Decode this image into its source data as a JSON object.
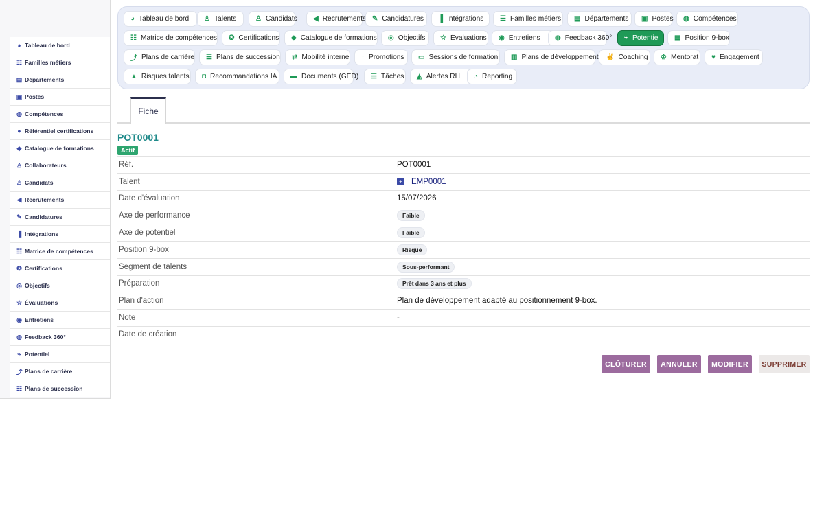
{
  "sidebar": {
    "items": [
      {
        "label": "Tableau de bord",
        "icon": "dashboard-icon",
        "glyph": "◕"
      },
      {
        "label": "Familles métiers",
        "icon": "sitemap-icon",
        "glyph": "☷"
      },
      {
        "label": "Départements",
        "icon": "building-icon",
        "glyph": "▤"
      },
      {
        "label": "Postes",
        "icon": "badge-icon",
        "glyph": "▣"
      },
      {
        "label": "Compétences",
        "icon": "brain-icon",
        "glyph": "◍"
      },
      {
        "label": "Référentiel certifications",
        "icon": "certificate-icon",
        "glyph": "●"
      },
      {
        "label": "Catalogue de formations",
        "icon": "graduation-cap-icon",
        "glyph": "◆"
      },
      {
        "label": "Collaborateurs",
        "icon": "user-icon",
        "glyph": "♙"
      },
      {
        "label": "Candidats",
        "icon": "user-plus-icon",
        "glyph": "♙"
      },
      {
        "label": "Recrutements",
        "icon": "bullhorn-icon",
        "glyph": "◀"
      },
      {
        "label": "Candidatures",
        "icon": "file-signature-icon",
        "glyph": "✎"
      },
      {
        "label": "Intégrations",
        "icon": "door-open-icon",
        "glyph": "▐"
      },
      {
        "label": "Matrice de compétences",
        "icon": "sitemap-icon",
        "glyph": "☷"
      },
      {
        "label": "Certifications",
        "icon": "award-icon",
        "glyph": "✪"
      },
      {
        "label": "Objectifs",
        "icon": "bullseye-icon",
        "glyph": "◎"
      },
      {
        "label": "Évaluations",
        "icon": "star-half-icon",
        "glyph": "☆"
      },
      {
        "label": "Entretiens",
        "icon": "comments-icon",
        "glyph": "◉"
      },
      {
        "label": "Feedback 360°",
        "icon": "comment-dots-icon",
        "glyph": "◍"
      },
      {
        "label": "Potentiel",
        "icon": "chart-line-icon",
        "glyph": "⌁"
      },
      {
        "label": "Plans de carrière",
        "icon": "route-icon",
        "glyph": "⤴"
      },
      {
        "label": "Plans de succession",
        "icon": "sitemap-icon",
        "glyph": "☷"
      }
    ]
  },
  "tabs": [
    {
      "label": "Tableau de bord",
      "icon": "dashboard-icon",
      "glyph": "◕"
    },
    {
      "label": "Talents",
      "icon": "user-icon",
      "glyph": "♙"
    },
    {
      "label": "Candidats",
      "icon": "user-plus-icon",
      "glyph": "♙"
    },
    {
      "label": "Recrutements",
      "icon": "bullhorn-icon",
      "glyph": "◀"
    },
    {
      "label": "Candidatures",
      "icon": "file-signature-icon",
      "glyph": "✎"
    },
    {
      "label": "Intégrations",
      "icon": "door-open-icon",
      "glyph": "▐"
    },
    {
      "label": "Familles métiers",
      "icon": "sitemap-icon",
      "glyph": "☷"
    },
    {
      "label": "Départements",
      "icon": "building-icon",
      "glyph": "▤"
    },
    {
      "label": "Postes",
      "icon": "badge-icon",
      "glyph": "▣"
    },
    {
      "label": "Compétences",
      "icon": "brain-icon",
      "glyph": "◍"
    },
    {
      "label": "Matrice de compétences",
      "icon": "sitemap-icon",
      "glyph": "☷"
    },
    {
      "label": "Certifications",
      "icon": "award-icon",
      "glyph": "✪"
    },
    {
      "label": "Catalogue de formations",
      "icon": "graduation-cap-icon",
      "glyph": "◆"
    },
    {
      "label": "Objectifs",
      "icon": "bullseye-icon",
      "glyph": "◎"
    },
    {
      "label": "Évaluations",
      "icon": "star-half-icon",
      "glyph": "☆"
    },
    {
      "label": "Entretiens",
      "icon": "comments-icon",
      "glyph": "◉"
    },
    {
      "label": "Feedback 360°",
      "icon": "comment-dots-icon",
      "glyph": "◍"
    },
    {
      "label": "Potentiel",
      "icon": "chart-line-icon",
      "glyph": "⌁",
      "active": true
    },
    {
      "label": "Position 9-box",
      "icon": "grid-icon",
      "glyph": "▦"
    },
    {
      "label": "Plans de carrière",
      "icon": "route-icon",
      "glyph": "⤴"
    },
    {
      "label": "Plans de succession",
      "icon": "sitemap-icon",
      "glyph": "☷"
    },
    {
      "label": "Mobilité interne",
      "icon": "exchange-icon",
      "glyph": "⇄"
    },
    {
      "label": "Promotions",
      "icon": "arrow-up-icon",
      "glyph": "↑"
    },
    {
      "label": "Sessions de formation",
      "icon": "chalkboard-icon",
      "glyph": "▭"
    },
    {
      "label": "Plans de développement",
      "icon": "clipboard-icon",
      "glyph": "▥"
    },
    {
      "label": "Coaching",
      "icon": "handshake-icon",
      "glyph": "✌"
    },
    {
      "label": "Mentorat",
      "icon": "user-tie-icon",
      "glyph": "♔"
    },
    {
      "label": "Engagement",
      "icon": "heart-icon",
      "glyph": "♥"
    },
    {
      "label": "Risques talents",
      "icon": "warning-icon",
      "glyph": "▲"
    },
    {
      "label": "Recommandations IA",
      "icon": "robot-icon",
      "glyph": "◘"
    },
    {
      "label": "Documents (GED)",
      "icon": "folder-open-icon",
      "glyph": "▬"
    },
    {
      "label": "Tâches",
      "icon": "tasks-icon",
      "glyph": "☰"
    },
    {
      "label": "Alertes RH",
      "icon": "bell-icon",
      "glyph": "◭"
    },
    {
      "label": "Reporting",
      "icon": "chart-pie-icon",
      "glyph": "◔"
    }
  ],
  "subtab": {
    "label": "Fiche"
  },
  "record": {
    "title": "POT0001",
    "status": "Actif",
    "fields": [
      {
        "label": "Réf.",
        "value": "POT0001",
        "kind": "text"
      },
      {
        "label": "Talent",
        "value": "EMP0001",
        "kind": "link"
      },
      {
        "label": "Date d'évaluation",
        "value": "15/07/2026",
        "kind": "text"
      },
      {
        "label": "Axe de performance",
        "value": "Faible",
        "kind": "pill"
      },
      {
        "label": "Axe de potentiel",
        "value": "Faible",
        "kind": "pill"
      },
      {
        "label": "Position 9-box",
        "value": "Risque",
        "kind": "pill"
      },
      {
        "label": "Segment de talents",
        "value": "Sous-performant",
        "kind": "pill"
      },
      {
        "label": "Préparation",
        "value": "Prêt dans 3 ans et plus",
        "kind": "pill"
      },
      {
        "label": "Plan d'action",
        "value": "Plan de développement adapté au positionnement 9-box.",
        "kind": "text"
      },
      {
        "label": "Note",
        "value": "-",
        "kind": "muted"
      },
      {
        "label": "Date de création",
        "value": "",
        "kind": "text"
      }
    ]
  },
  "actions": {
    "close_label": "CLÔTURER",
    "cancel_label": "ANNULER",
    "edit_label": "MODIFIER",
    "delete_label": "SUPPRIMER"
  },
  "colors": {
    "accent": "#1f9a57",
    "title": "#1f8a8a",
    "action": "#9c6b9e"
  }
}
